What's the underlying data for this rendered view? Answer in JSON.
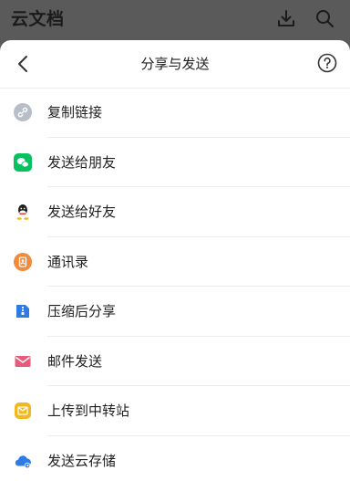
{
  "app": {
    "title": "云文档"
  },
  "toolbar": {
    "download_icon": "download-icon",
    "search_icon": "search-icon"
  },
  "sheet": {
    "title": "分享与发送",
    "items": [
      {
        "label": "复制链接",
        "icon": "link-icon",
        "color": "#b7bec8"
      },
      {
        "label": "发送给朋友",
        "icon": "wechat-icon",
        "color": "#07c160"
      },
      {
        "label": "发送给好友",
        "icon": "qq-icon",
        "color": "#1f1f1f"
      },
      {
        "label": "通讯录",
        "icon": "contacts-icon",
        "color": "#f08a3c"
      },
      {
        "label": "压缩后分享",
        "icon": "zip-icon",
        "color": "#2e7be6"
      },
      {
        "label": "邮件发送",
        "icon": "mail-icon",
        "color": "#e65a7a"
      },
      {
        "label": "上传到中转站",
        "icon": "transfer-station-icon",
        "color": "#f2b81d"
      },
      {
        "label": "发送云存储",
        "icon": "cloud-storage-icon",
        "color": "#2e7be6"
      }
    ]
  }
}
